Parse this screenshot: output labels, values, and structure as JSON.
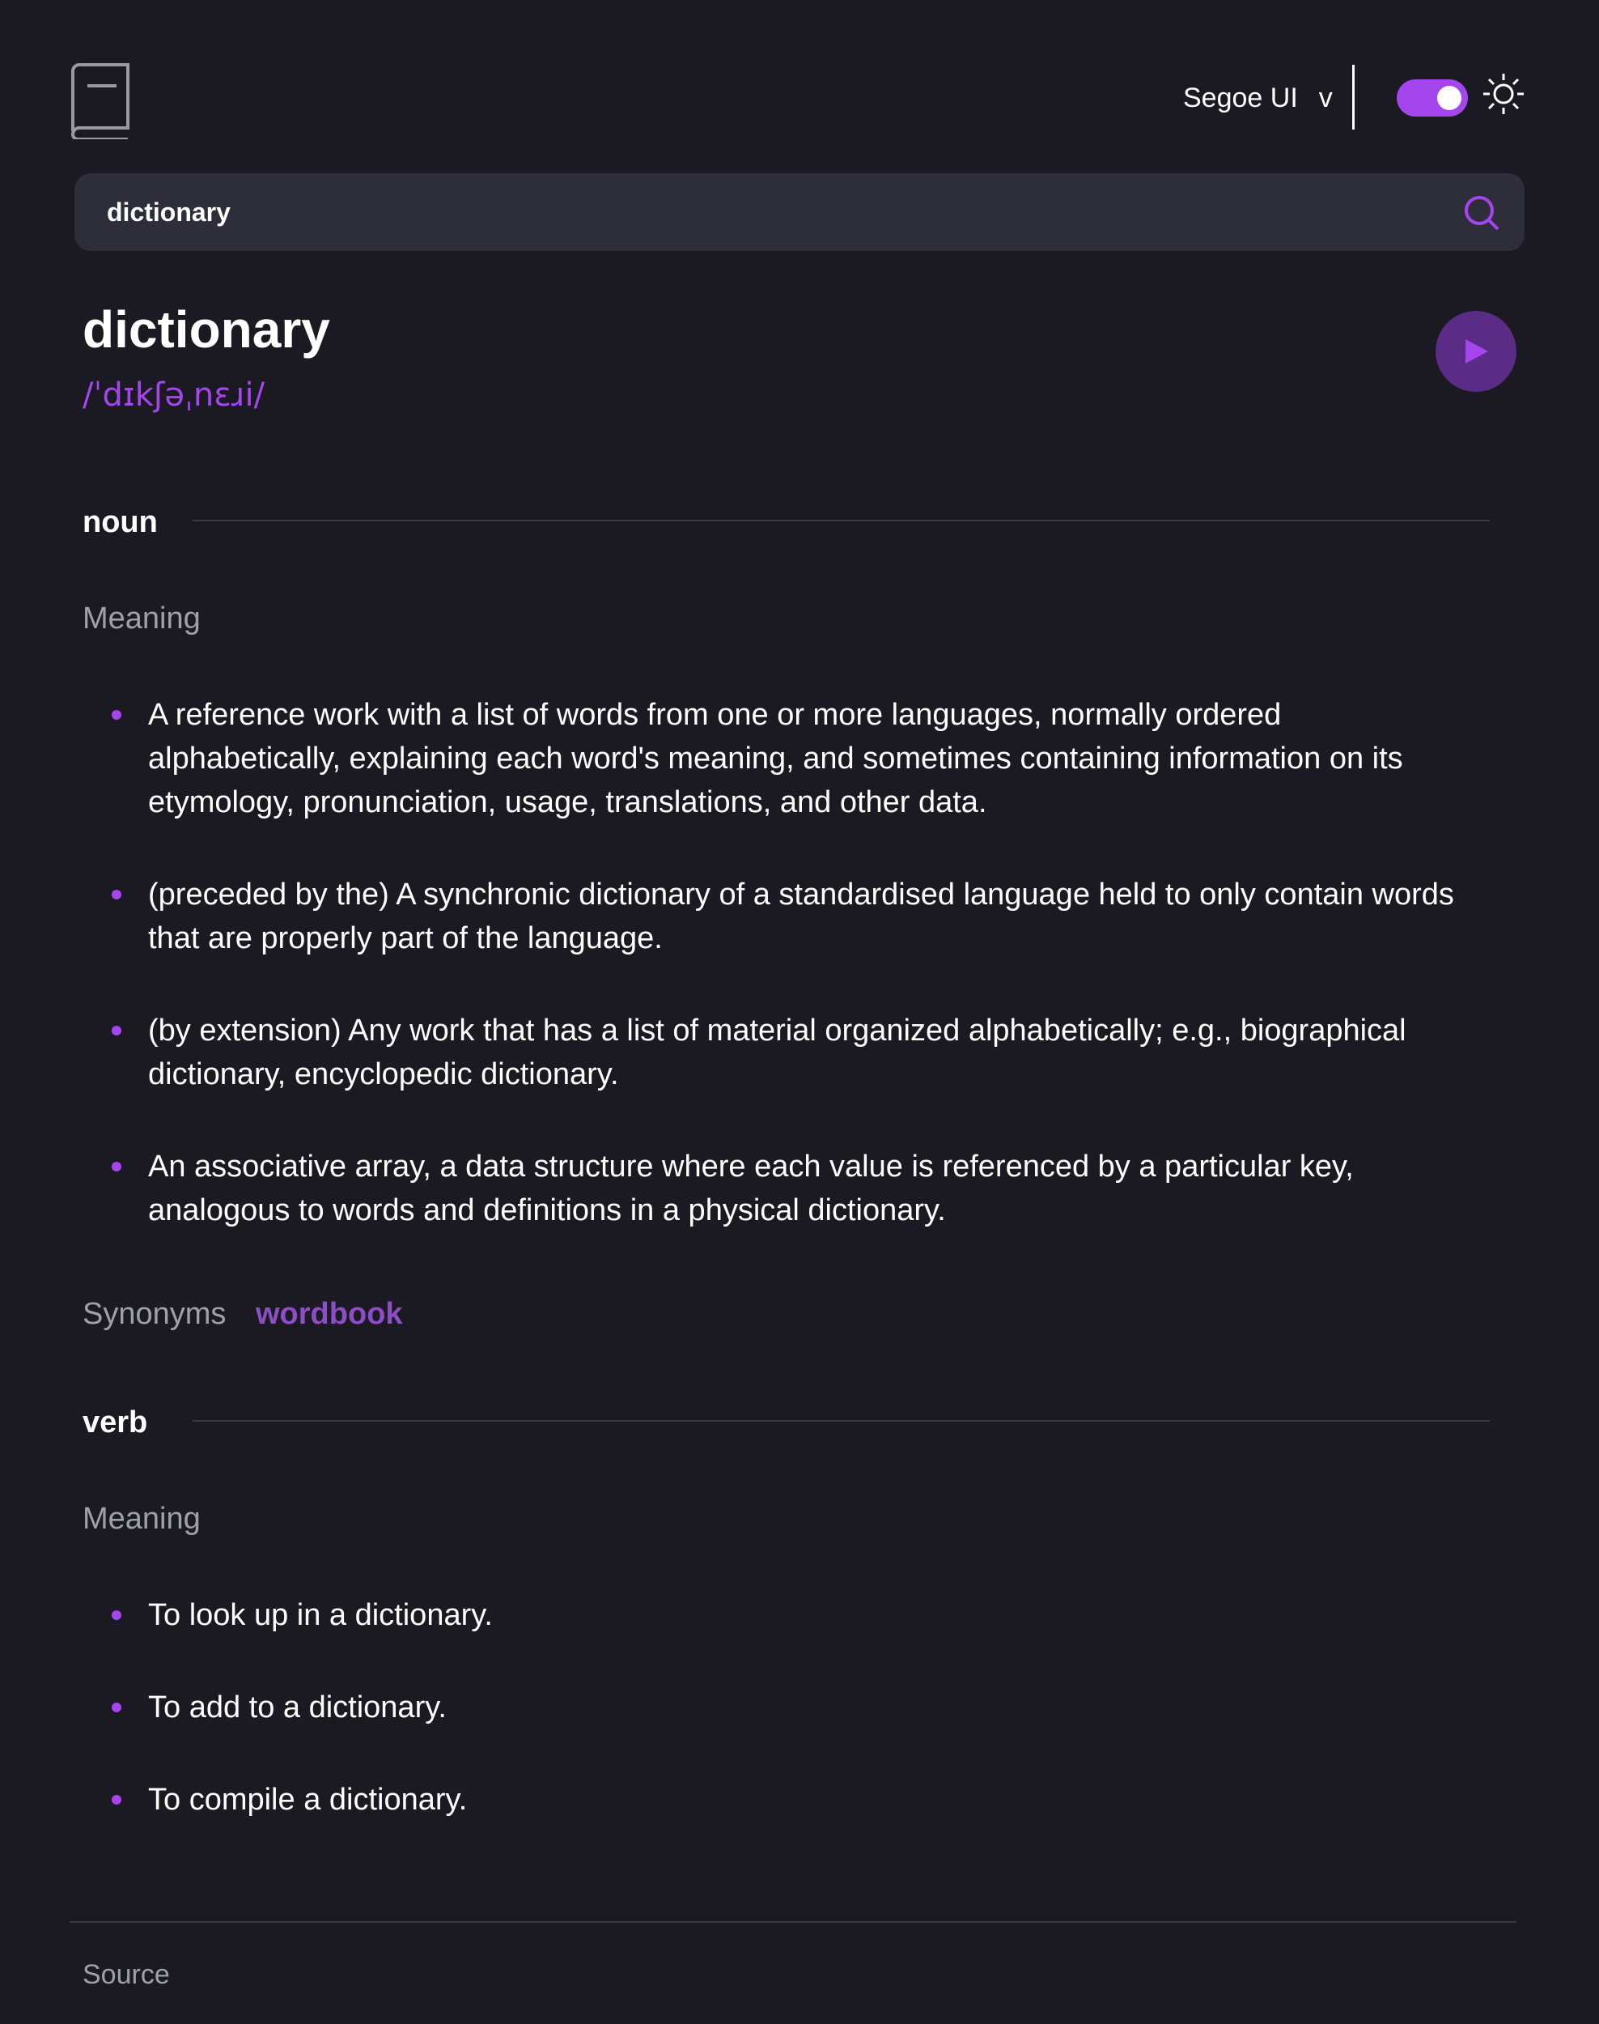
{
  "header": {
    "logo_icon": "book-icon",
    "font_selector": {
      "value": "Segoe UI",
      "caret": "v"
    },
    "theme_toggle": {
      "state": "on",
      "accent": "#a445ed"
    },
    "theme_icon": "sun-icon"
  },
  "search": {
    "value": "dictionary",
    "icon": "search-icon"
  },
  "entry": {
    "word": "dictionary",
    "phonetic": "/ˈdɪkʃəˌnɛɹi/",
    "play_icon": "play-icon"
  },
  "noun": {
    "part_of_speech": "noun",
    "meaning_label": "Meaning",
    "definitions": [
      "A reference work with a list of words from one or more languages, normally ordered alphabetically, explaining each word's meaning, and sometimes containing information on its etymology, pronunciation, usage, translations, and other data.",
      "(preceded by the) A synchronic dictionary of a standardised language held to only contain words that are properly part of the language.",
      "(by extension) Any work that has a list of material organized alphabetically; e.g., biographical dictionary, encyclopedic dictionary.",
      "An associative array, a data structure where each value is referenced by a particular key, analogous to words and definitions in a physical dictionary."
    ],
    "synonyms_label": "Synonyms",
    "synonym": "wordbook"
  },
  "verb": {
    "part_of_speech": "verb",
    "meaning_label": "Meaning",
    "definitions": [
      "To look up in a dictionary.",
      "To add to a dictionary.",
      "To compile a dictionary."
    ]
  },
  "footer": {
    "source_label": "Source"
  },
  "colors": {
    "background": "#1b1a23",
    "accent": "#a445ed",
    "muted": "#a0a0a8",
    "search_bg": "#2e2d3a"
  }
}
